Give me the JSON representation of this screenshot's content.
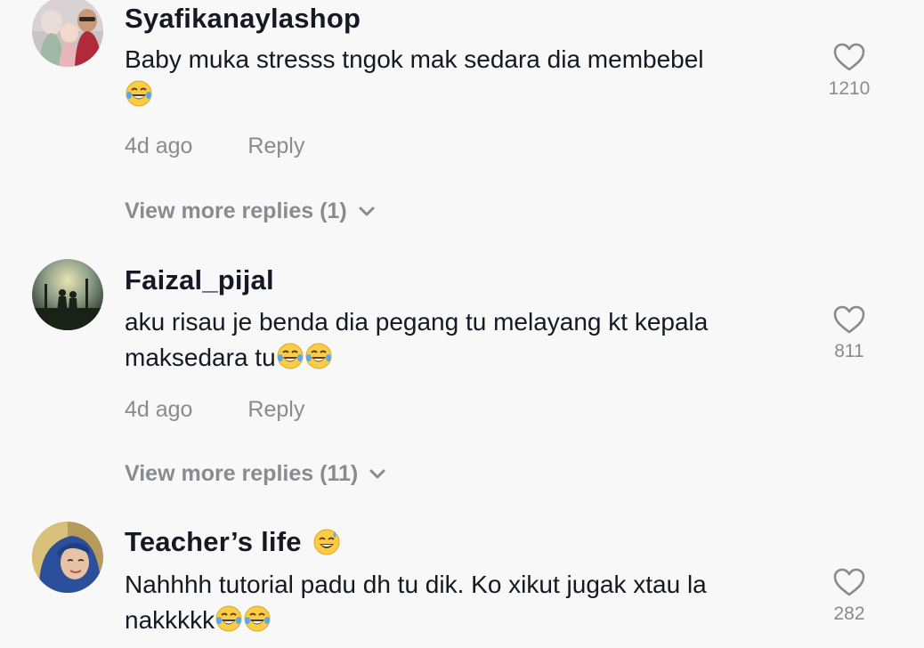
{
  "comments": [
    {
      "username": "Syafikanaylashop",
      "text": "Baby muka stresss tngok mak sedara dia membebel",
      "time": "4d ago",
      "reply_label": "Reply",
      "like_count": "1210",
      "view_more": "View more replies (1)",
      "avatar_icon": "family-photo-avatar"
    },
    {
      "username": "Faizal_pijal",
      "text": "aku risau je benda dia pegang tu melayang kt kepala maksedara tu",
      "time": "4d ago",
      "reply_label": "Reply",
      "like_count": "811",
      "view_more": "View more replies (11)",
      "avatar_icon": "silhouette-sunset-avatar"
    },
    {
      "username": "Teacher’s life",
      "text": "Nahhhh tutorial padu dh tu dik. Ko xikut jugak xtau la nakkkkk",
      "like_count": "282",
      "avatar_icon": "hijab-woman-avatar"
    }
  ],
  "icons": {
    "like": "heart-outline-icon",
    "expand": "chevron-down-icon",
    "laugh": "face-with-tears-of-joy-emoji",
    "sweat": "grinning-face-with-sweat-emoji"
  },
  "colors": {
    "background": "#f8f8f8",
    "primary_text": "#161823",
    "secondary_text": "#8a8b91"
  }
}
